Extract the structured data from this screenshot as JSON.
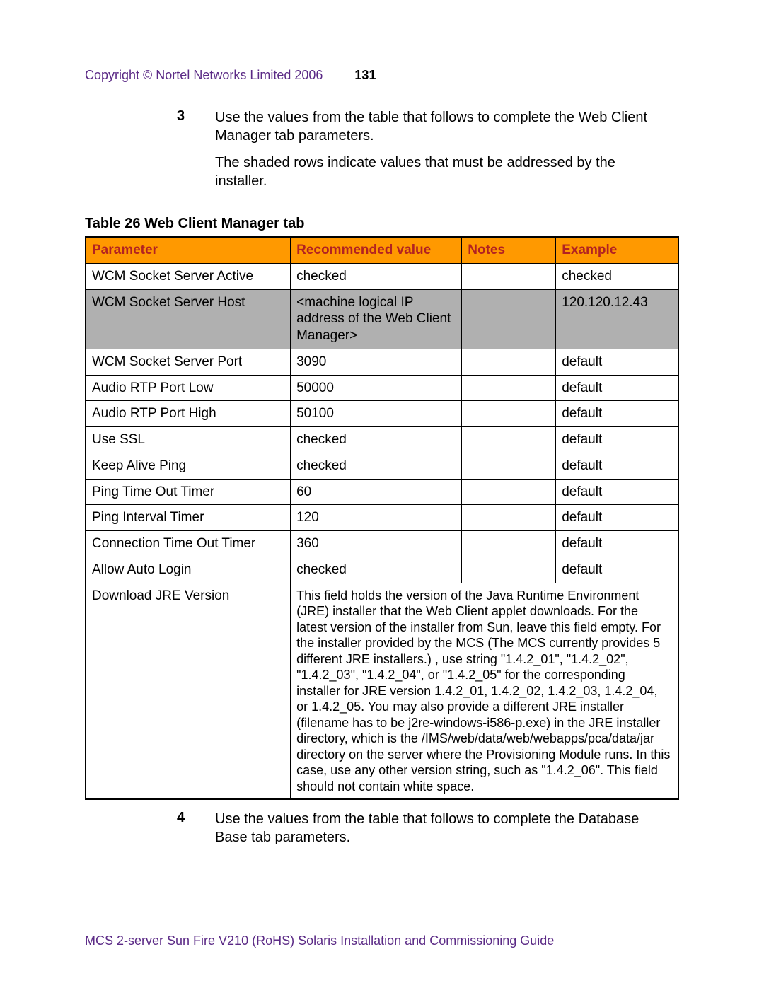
{
  "header": {
    "copyright": "Copyright © Nortel Networks Limited 2006",
    "page_number": "131"
  },
  "steps": {
    "three": {
      "num": "3",
      "para1": "Use the values from the table that follows to complete the Web Client Manager tab parameters.",
      "para2": "The shaded rows indicate values that must be addressed by the installer."
    },
    "four": {
      "num": "4",
      "para1": "Use the values from the table that follows to complete the Database Base tab parameters."
    }
  },
  "table": {
    "title": "Table 26  Web Client Manager tab",
    "headers": {
      "parameter": "Parameter",
      "recommended": "Recommended value",
      "notes": "Notes",
      "example": "Example"
    },
    "rows": {
      "r0": {
        "parameter": "WCM Socket Server Active",
        "recommended": "checked",
        "notes": "",
        "example": "checked"
      },
      "r1": {
        "parameter": "WCM Socket Server Host",
        "recommended": "<machine logical IP address of the Web Client Manager>",
        "notes": "",
        "example": "120.120.12.43"
      },
      "r2": {
        "parameter": "WCM Socket Server Port",
        "recommended": "3090",
        "notes": "",
        "example": "default"
      },
      "r3": {
        "parameter": "Audio RTP Port Low",
        "recommended": "50000",
        "notes": "",
        "example": "default"
      },
      "r4": {
        "parameter": "Audio RTP Port High",
        "recommended": "50100",
        "notes": "",
        "example": "default"
      },
      "r5": {
        "parameter": "Use SSL",
        "recommended": "checked",
        "notes": "",
        "example": "default"
      },
      "r6": {
        "parameter": "Keep Alive Ping",
        "recommended": "checked",
        "notes": "",
        "example": "default"
      },
      "r7": {
        "parameter": "Ping Time Out Timer",
        "recommended": "60",
        "notes": "",
        "example": "default"
      },
      "r8": {
        "parameter": "Ping Interval Timer",
        "recommended": "120",
        "notes": "",
        "example": "default"
      },
      "r9": {
        "parameter": "Connection Time Out Timer",
        "recommended": "360",
        "notes": "",
        "example": "default"
      },
      "r10": {
        "parameter": "Allow Auto Login",
        "recommended": "checked",
        "notes": "",
        "example": "default"
      },
      "r11": {
        "parameter": "Download JRE Version",
        "jre_note": "This field holds the version of the Java Runtime Environment (JRE) installer that the Web Client applet downloads. For the latest version of the installer from Sun, leave this field empty. For the installer provided by the MCS (The MCS currently provides 5 different JRE installers.) , use string \"1.4.2_01\", \"1.4.2_02\", \"1.4.2_03\", \"1.4.2_04\", or \"1.4.2_05\" for the corresponding installer for JRE version 1.4.2_01, 1.4.2_02, 1.4.2_03, 1.4.2_04, or 1.4.2_05. You may also provide a different JRE installer (filename has to be j2re-windows-i586-p.exe) in the JRE installer directory, which is the /IMS/web/data/web/webapps/pca/data/jar directory on the server where the Provisioning Module runs. In this case, use any other version string, such as \"1.4.2_06\". This field should not contain white space."
      }
    }
  },
  "footer": "MCS 2-server Sun Fire V210 (RoHS) Solaris Installation and Commissioning Guide"
}
